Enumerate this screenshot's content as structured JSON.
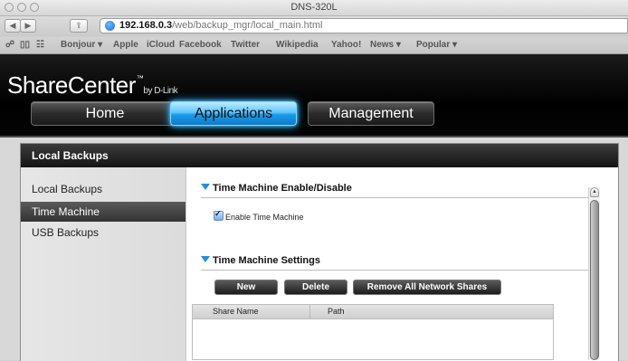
{
  "window": {
    "title": "DNS-320L"
  },
  "toolbar": {
    "back_glyph": "◀",
    "forward_glyph": "▶",
    "share_glyph": "⇪",
    "url_host": "192.168.0.3",
    "url_path": "/web/backup_mgr/local_main.html"
  },
  "bookmarks": {
    "items": [
      "Bonjour ▾",
      "Apple",
      "iCloud",
      "Facebook",
      "Twitter",
      "Wikipedia",
      "Yahoo!",
      "News ▾",
      "Popular ▾"
    ]
  },
  "brand": {
    "name": "ShareCenter",
    "tm": "™",
    "by": "by D-Link"
  },
  "nav": {
    "tabs": [
      "Home",
      "Applications",
      "Management"
    ],
    "active": "Applications"
  },
  "panel": {
    "title": "Local Backups"
  },
  "sidebar": {
    "items": [
      "Local Backups",
      "Time Machine",
      "USB Backups"
    ],
    "selected": "Time Machine"
  },
  "time_machine": {
    "enable_section_title": "Time Machine Enable/Disable",
    "enable_label": "Enable Time Machine",
    "enable_checked": true,
    "settings_section_title": "Time Machine Settings",
    "buttons": {
      "new": "New",
      "delete": "Delete",
      "remove_all": "Remove All Network Shares"
    },
    "table": {
      "columns": [
        "Share Name",
        "Path"
      ],
      "rows": []
    }
  },
  "colors": {
    "accent": "#1a8fe3",
    "active_tab": "#5ec6ff",
    "header_bg": "#000000"
  }
}
